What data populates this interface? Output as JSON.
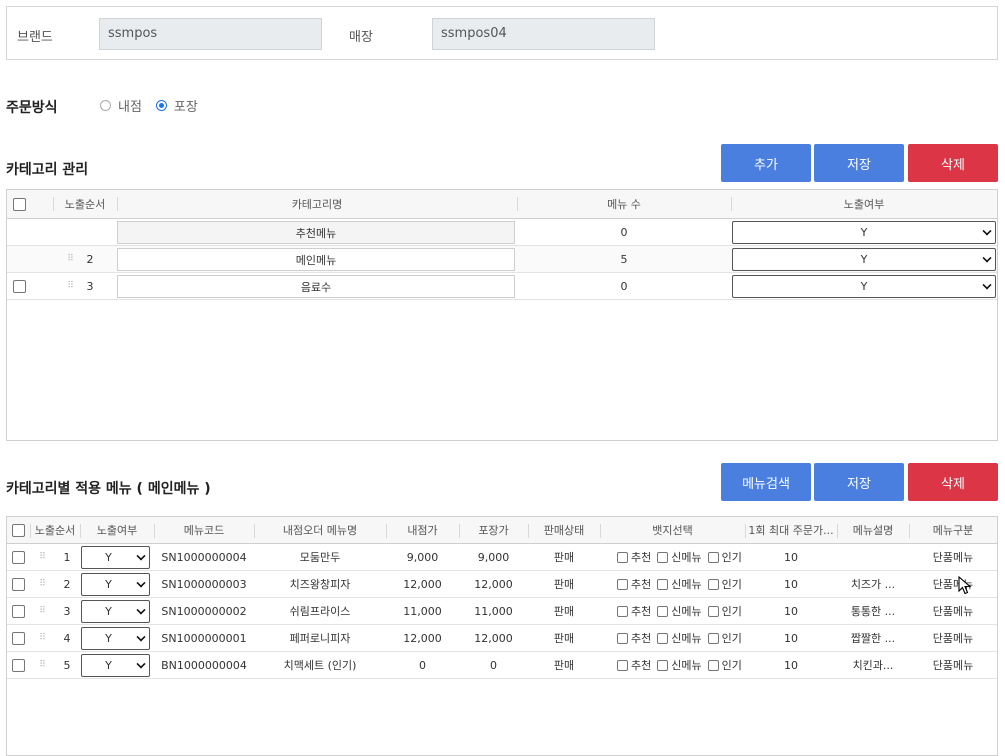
{
  "store_info": {
    "brand_label": "브랜드",
    "brand_value": "ssmpos",
    "store_label": "매장",
    "store_value": "ssmpos04"
  },
  "order_method": {
    "title": "주문방식",
    "options": [
      {
        "label": "내점",
        "selected": false
      },
      {
        "label": "포장",
        "selected": true
      }
    ]
  },
  "category_section": {
    "title": "카테고리 관리",
    "buttons": {
      "add": "추가",
      "save": "저장",
      "delete": "삭제"
    },
    "columns": {
      "order": "노출순서",
      "name": "카테고리명",
      "required_mark": "*",
      "menu_count": "메뉴 수",
      "visible": "노출여부"
    },
    "rows": [
      {
        "order": "",
        "name": "추천메뉴",
        "menu_count": "0",
        "visible": "Y",
        "checkbox": false,
        "drag": false
      },
      {
        "order": "2",
        "name": "메인메뉴",
        "menu_count": "5",
        "visible": "Y",
        "checkbox": false,
        "drag": true
      },
      {
        "order": "3",
        "name": "음료수",
        "menu_count": "0",
        "visible": "Y",
        "checkbox": true,
        "drag": true
      }
    ]
  },
  "menu_section": {
    "title": "카테고리별 적용 메뉴 ( 메인메뉴 )",
    "buttons": {
      "search": "메뉴검색",
      "save": "저장",
      "delete": "삭제"
    },
    "columns": {
      "order": "노출순서",
      "visible": "노출여부",
      "code": "메뉴코드",
      "name": "내점오더 메뉴명",
      "dine_price": "내점가",
      "takeout_price": "포장가",
      "status": "판매상태",
      "badge": "뱃지선택",
      "max_qty": "1회 최대 주문가...",
      "desc": "메뉴설명",
      "type": "메뉴구분"
    },
    "badge_labels": [
      "추천",
      "신메뉴",
      "인기"
    ],
    "rows": [
      {
        "order": "1",
        "visible": "Y",
        "code": "SN1000000004",
        "name": "모둠만두",
        "dine_price": "9,000",
        "takeout_price": "9,000",
        "status": "판매",
        "max_qty": "10",
        "desc": "",
        "type": "단품메뉴"
      },
      {
        "order": "2",
        "visible": "Y",
        "code": "SN1000000003",
        "name": "치즈왕창피자",
        "dine_price": "12,000",
        "takeout_price": "12,000",
        "status": "판매",
        "max_qty": "10",
        "desc": "치즈가 ...",
        "type": "단품메뉴"
      },
      {
        "order": "3",
        "visible": "Y",
        "code": "SN1000000002",
        "name": "쉬림프라이스",
        "dine_price": "11,000",
        "takeout_price": "11,000",
        "status": "판매",
        "max_qty": "10",
        "desc": "통통한 ...",
        "type": "단품메뉴"
      },
      {
        "order": "4",
        "visible": "Y",
        "code": "SN1000000001",
        "name": "페퍼로니피자",
        "dine_price": "12,000",
        "takeout_price": "12,000",
        "status": "판매",
        "max_qty": "10",
        "desc": "짭짤한 ...",
        "type": "단품메뉴"
      },
      {
        "order": "5",
        "visible": "Y",
        "code": "BN1000000004",
        "name": "치맥세트 (인기)",
        "dine_price": "0",
        "takeout_price": "0",
        "status": "판매",
        "max_qty": "10",
        "desc": "치킨과...",
        "type": "단품메뉴"
      }
    ]
  },
  "colors": {
    "primary": "#4a7fe0",
    "danger": "#dc3545"
  },
  "icons": [
    "checkbox-icon",
    "drag-handle-icon",
    "chevron-down-icon",
    "mouse-cursor-icon"
  ]
}
